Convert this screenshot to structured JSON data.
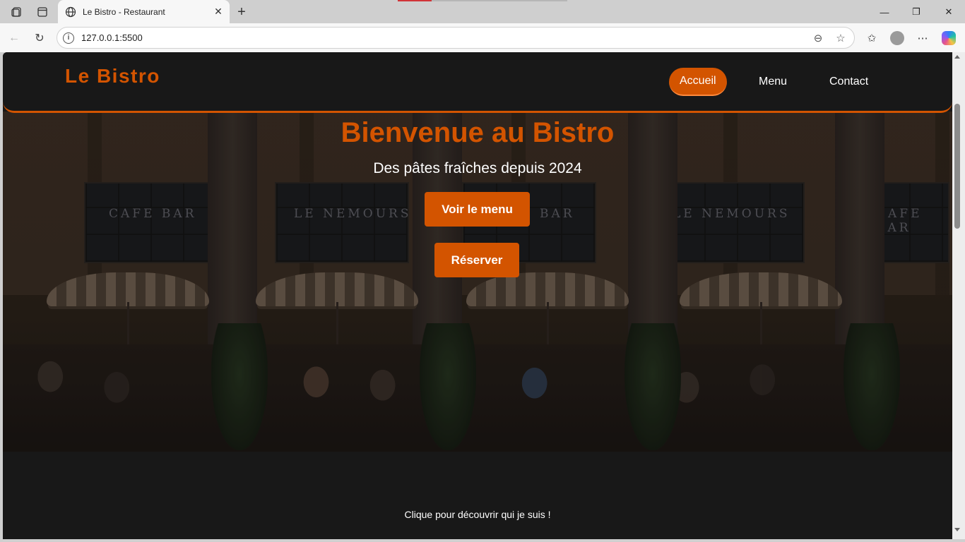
{
  "browser": {
    "tab_title": "Le Bistro - Restaurant",
    "url": "127.0.0.1:5500",
    "tab_close": "✕",
    "new_tab": "+",
    "minimize": "—",
    "maximize": "❐",
    "close": "✕"
  },
  "header": {
    "brand": "Le Bistro",
    "nav": [
      {
        "label": "Accueil",
        "active": true
      },
      {
        "label": "Menu",
        "active": false
      },
      {
        "label": "Contact",
        "active": false
      }
    ]
  },
  "hero": {
    "title": "Bienvenue au Bistro",
    "subtitle": "Des pâtes fraîches depuis 2024",
    "primary_button": "Voir le menu",
    "secondary_button": "Réserver",
    "signs": [
      "CAFE BAR",
      "LE NEMOURS",
      "BAR",
      "LE NEMOURS",
      "CAFE BAR"
    ]
  },
  "footer": {
    "text": "Clique pour découvrir qui je suis !"
  },
  "colors": {
    "accent": "#d35400",
    "page_bg": "#181818",
    "text": "#ffffff"
  }
}
